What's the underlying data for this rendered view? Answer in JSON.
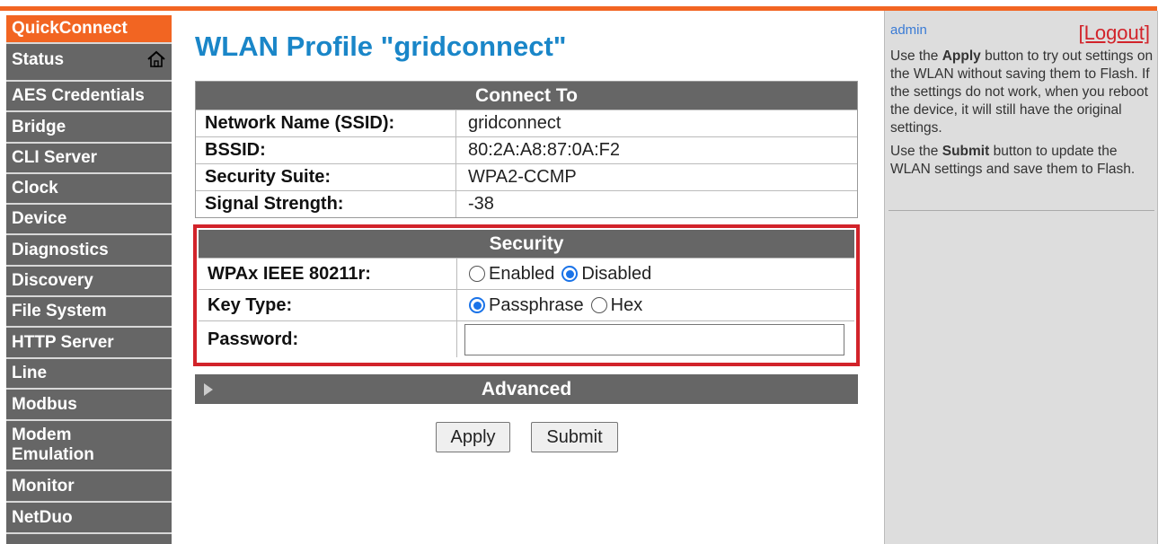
{
  "sidebar": {
    "items": [
      {
        "label": "QuickConnect",
        "active": true
      },
      {
        "label": "Status",
        "icon": "home-icon"
      },
      {
        "label": "AES Credentials"
      },
      {
        "label": "Bridge"
      },
      {
        "label": "CLI Server"
      },
      {
        "label": "Clock"
      },
      {
        "label": "Device"
      },
      {
        "label": "Diagnostics"
      },
      {
        "label": "Discovery"
      },
      {
        "label": "File System"
      },
      {
        "label": "HTTP Server"
      },
      {
        "label": "Line"
      },
      {
        "label": "Modbus"
      },
      {
        "label": "Modem Emulation"
      },
      {
        "label": "Monitor"
      },
      {
        "label": "NetDuo"
      }
    ]
  },
  "main": {
    "title": "WLAN Profile \"gridconnect\"",
    "connect": {
      "heading": "Connect To",
      "rows": [
        {
          "label": "Network Name (SSID):",
          "value": "gridconnect"
        },
        {
          "label": "BSSID:",
          "value": "80:2A:A8:87:0A:F2"
        },
        {
          "label": "Security Suite:",
          "value": "WPA2-CCMP"
        },
        {
          "label": "Signal Strength:",
          "value": "-38"
        }
      ]
    },
    "security": {
      "heading": "Security",
      "wpax_label": "WPAx IEEE 80211r:",
      "wpax_enabled": "Enabled",
      "wpax_disabled": "Disabled",
      "wpax_selected": "Disabled",
      "keytype_label": "Key Type:",
      "keytype_passphrase": "Passphrase",
      "keytype_hex": "Hex",
      "keytype_selected": "Passphrase",
      "password_label": "Password:",
      "password_value": ""
    },
    "advanced": {
      "heading": "Advanced"
    },
    "buttons": {
      "apply": "Apply",
      "submit": "Submit"
    }
  },
  "help": {
    "user": "admin",
    "logout": "[Logout]",
    "p1_pre": "Use the ",
    "p1_bold": "Apply",
    "p1_post": " button to try out settings on the WLAN without saving them to Flash. If the settings do not work, when you reboot the device, it will still have the original settings.",
    "p2_pre": "Use the ",
    "p2_bold": "Submit",
    "p2_post": " button to update the WLAN settings and save them to Flash."
  },
  "colors": {
    "accent": "#f26522",
    "title_blue": "#1a86c8",
    "highlight_red": "#d2232a",
    "nav_gray": "#666666"
  }
}
